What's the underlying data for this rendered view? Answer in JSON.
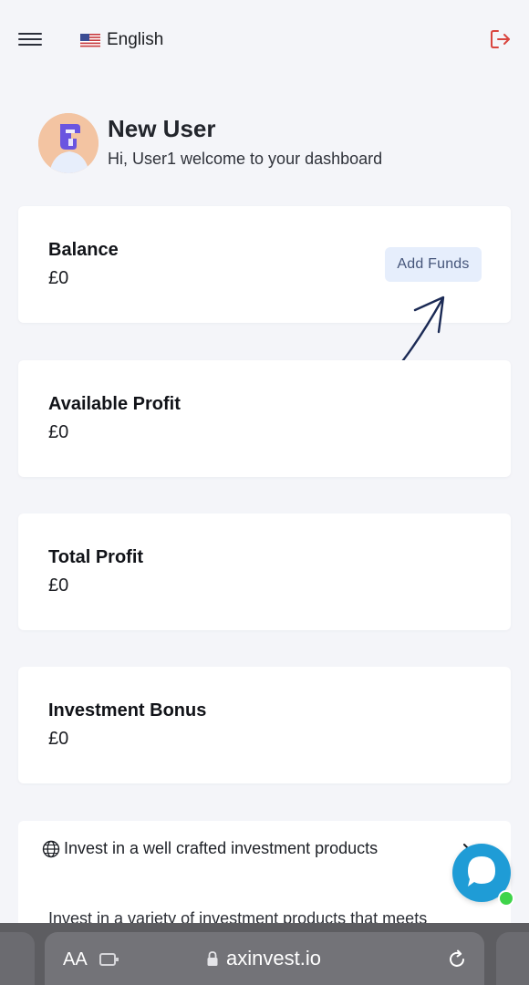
{
  "header": {
    "language": "English",
    "accent_color": "#d9453f"
  },
  "user": {
    "name": "New User",
    "welcome": "Hi, User1 welcome to your dashboard"
  },
  "cards": [
    {
      "title": "Balance",
      "value": "£0",
      "action_label": "Add Funds"
    },
    {
      "title": "Available Profit",
      "value": "£0"
    },
    {
      "title": "Total Profit",
      "value": "£0"
    },
    {
      "title": "Investment Bonus",
      "value": "£0"
    }
  ],
  "invest": {
    "title": "Invest in a well crafted investment products",
    "description": "Invest in a variety of investment products that meets"
  },
  "browser": {
    "text_size_label": "AA",
    "url": "axinvest.io"
  },
  "icons": {
    "menu": "hamburger-icon",
    "language": "us-flag-icon",
    "logout": "logout-icon",
    "globe": "globe-icon",
    "chevron": "chevron-right-icon",
    "chat": "chat-icon",
    "lock": "lock-icon",
    "reload": "reload-icon"
  }
}
